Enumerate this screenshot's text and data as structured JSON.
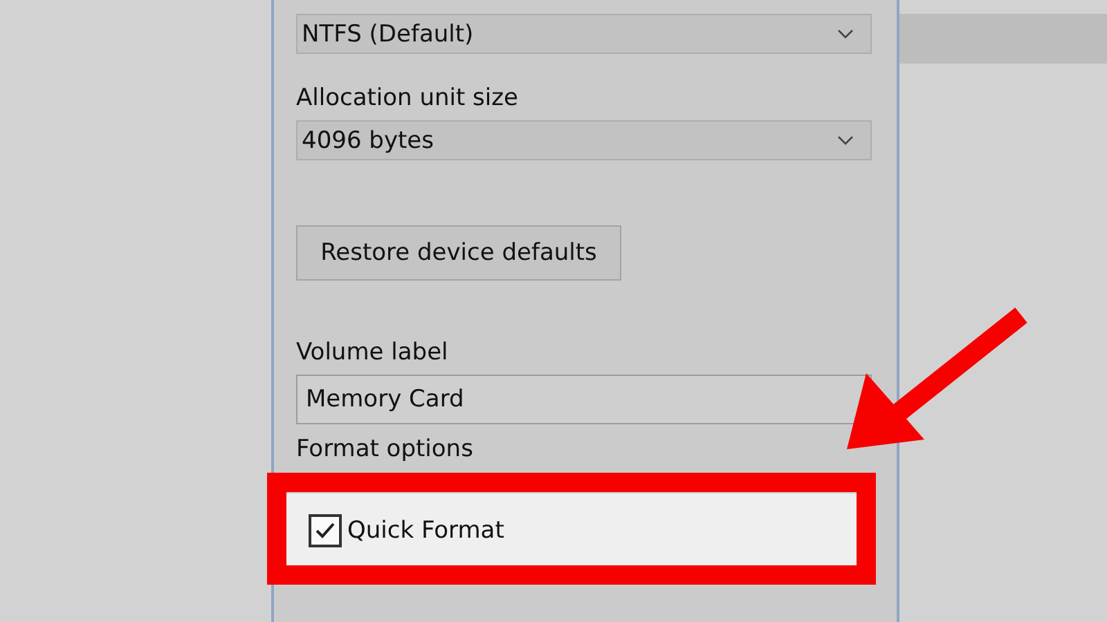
{
  "file_system": {
    "value": "NTFS (Default)"
  },
  "allocation_unit_size": {
    "label": "Allocation unit size",
    "value": "4096 bytes"
  },
  "restore_button": {
    "label": "Restore device defaults"
  },
  "volume_label": {
    "label": "Volume label",
    "value": "Memory Card"
  },
  "format_options": {
    "label": "Format options",
    "options": [
      {
        "label": "Quick Format",
        "checked": true,
        "highlighted": true
      }
    ]
  }
}
